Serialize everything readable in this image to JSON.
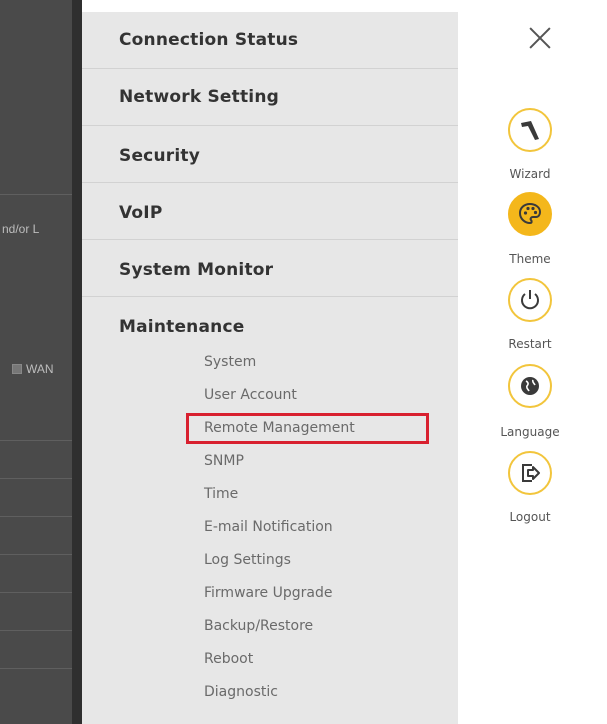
{
  "background": {
    "partial_text": "nd/or L",
    "wan_label": "WAN"
  },
  "menu": {
    "sections": [
      {
        "label": "Connection Status"
      },
      {
        "label": "Network Setting"
      },
      {
        "label": "Security"
      },
      {
        "label": "VoIP"
      },
      {
        "label": "System Monitor"
      },
      {
        "label": "Maintenance"
      }
    ],
    "maintenance_items": [
      {
        "label": "System"
      },
      {
        "label": "User Account"
      },
      {
        "label": "Remote Management",
        "highlighted": true
      },
      {
        "label": "SNMP"
      },
      {
        "label": "Time"
      },
      {
        "label": "E-mail Notification"
      },
      {
        "label": "Log Settings"
      },
      {
        "label": "Firmware Upgrade"
      },
      {
        "label": "Backup/Restore"
      },
      {
        "label": "Reboot"
      },
      {
        "label": "Diagnostic"
      }
    ]
  },
  "right_bar": {
    "close_icon": "close-icon",
    "buttons": [
      {
        "label": "Wizard",
        "icon": "wizard-icon"
      },
      {
        "label": "Theme",
        "icon": "theme-icon",
        "active": true
      },
      {
        "label": "Restart",
        "icon": "power-icon"
      },
      {
        "label": "Language",
        "icon": "globe-icon"
      },
      {
        "label": "Logout",
        "icon": "logout-icon"
      }
    ]
  },
  "colors": {
    "accent": "#f4b71b",
    "highlight_border": "#d8202f",
    "menu_bg": "#e7e7e7"
  }
}
